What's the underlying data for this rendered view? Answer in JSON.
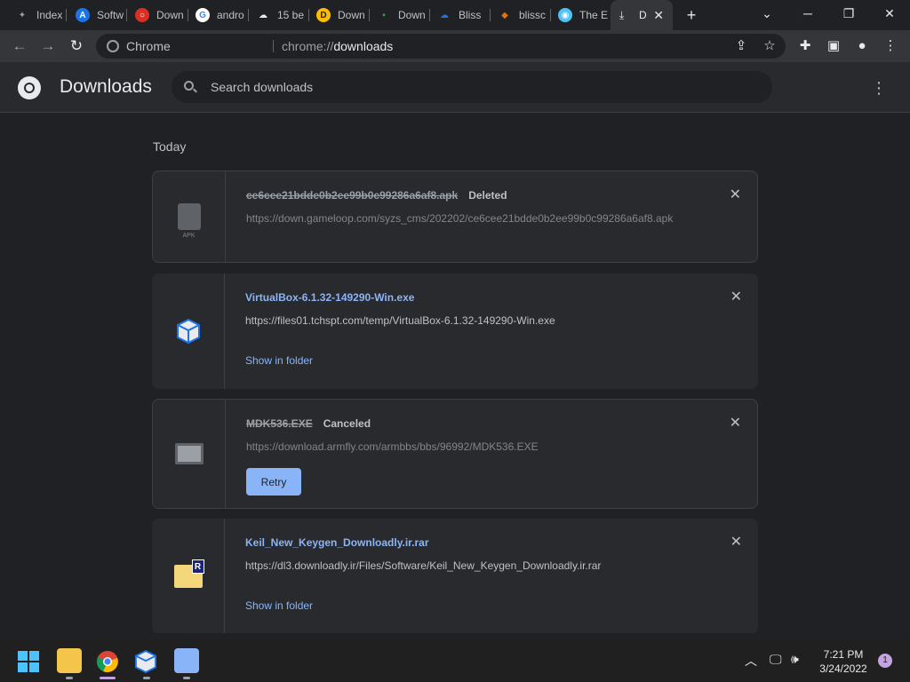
{
  "browser": {
    "tabs": [
      {
        "label": "Index",
        "color": "#9aa0a6",
        "glyph": "✦"
      },
      {
        "label": "Softw",
        "color": "#1a73e8",
        "glyph": "A"
      },
      {
        "label": "Down",
        "color": "#d93025",
        "glyph": "○"
      },
      {
        "label": "andro",
        "color": "#ffffff",
        "glyph": "G"
      },
      {
        "label": "15 be",
        "color": "#5f6368",
        "glyph": "☁"
      },
      {
        "label": "Down",
        "color": "#fbbc04",
        "glyph": "D"
      },
      {
        "label": "Down",
        "color": "#188038",
        "glyph": "▪"
      },
      {
        "label": "Bliss",
        "color": "#1a73e8",
        "glyph": "☁"
      },
      {
        "label": "blissc",
        "color": "#e37400",
        "glyph": "◆"
      },
      {
        "label": "The E",
        "color": "#4fc3f7",
        "glyph": "◉"
      }
    ],
    "active_tab": {
      "label": "D",
      "icon": "download-icon"
    },
    "new_tab_label": "+",
    "window_controls": {
      "dropdown": "⌄",
      "minimize": "─",
      "restore": "❐",
      "close": "✕"
    },
    "omnibox": {
      "chip": "Chrome",
      "url_scheme": "chrome://",
      "url_path": "downloads"
    }
  },
  "header": {
    "title": "Downloads",
    "search_placeholder": "Search downloads"
  },
  "section": "Today",
  "downloads": [
    {
      "name": "ce6cee21bdde0b2ee99b0c99286a6af8.apk",
      "status": "Deleted",
      "url": "https://down.gameloop.com/syzs_cms/202202/ce6cee21bdde0b2ee99b0c99286a6af8.apk",
      "icon": "apk-file-icon",
      "icon_label": "APK"
    },
    {
      "name": "VirtualBox-6.1.32-149290-Win.exe",
      "status": "",
      "url": "https://files01.tchspt.com/temp/VirtualBox-6.1.32-149290-Win.exe",
      "icon": "virtualbox-icon",
      "action": "Show in folder"
    },
    {
      "name": "MDK536.EXE",
      "status": "Canceled",
      "url": "https://download.armfly.com/armbbs/bbs/96992/MDK536.EXE",
      "icon": "exe-file-icon",
      "action": "Retry"
    },
    {
      "name": "Keil_New_Keygen_Downloadly.ir.rar",
      "status": "",
      "url": "https://dl3.downloadly.ir/Files/Software/Keil_New_Keygen_Downloadly.ir.rar",
      "icon": "rar-archive-icon",
      "icon_label": "R",
      "action": "Show in folder"
    }
  ],
  "taskbar": {
    "time": "7:21 PM",
    "date": "3/24/2022",
    "notification_count": "1"
  }
}
